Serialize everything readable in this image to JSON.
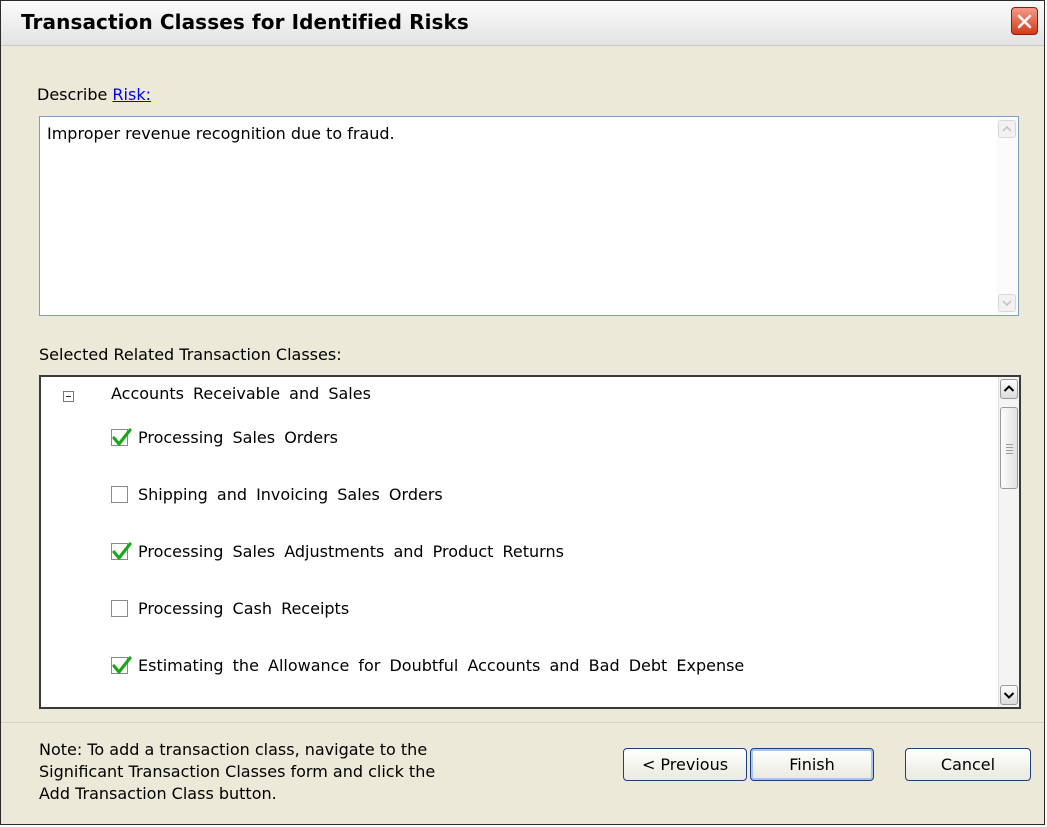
{
  "window": {
    "title": "Transaction Classes for Identified Risks",
    "close_icon": "close-icon"
  },
  "describe": {
    "label": "Describe",
    "link": "Risk:",
    "text": "Improper revenue recognition due to fraud."
  },
  "tree": {
    "label": "Selected Related Transaction Classes:",
    "group": "Accounts Receivable and Sales",
    "items": [
      {
        "label": "Processing Sales Orders",
        "checked": true
      },
      {
        "label": "Shipping and Invoicing Sales Orders",
        "checked": false
      },
      {
        "label": "Processing Sales Adjustments and Product Returns",
        "checked": true
      },
      {
        "label": "Processing Cash Receipts",
        "checked": false
      },
      {
        "label": "Estimating the Allowance for Doubtful Accounts and Bad Debt Expense",
        "checked": true
      }
    ]
  },
  "note": {
    "line1": "Note: To add a transaction class, navigate to the",
    "line2": "Significant Transaction Classes form and click the",
    "line3": "Add Transaction Class button."
  },
  "buttons": {
    "previous": "< Previous",
    "finish": "Finish",
    "cancel": "Cancel"
  },
  "colors": {
    "check": "#1aa81a",
    "link": "#0000ee",
    "close": "#d43a1a"
  }
}
